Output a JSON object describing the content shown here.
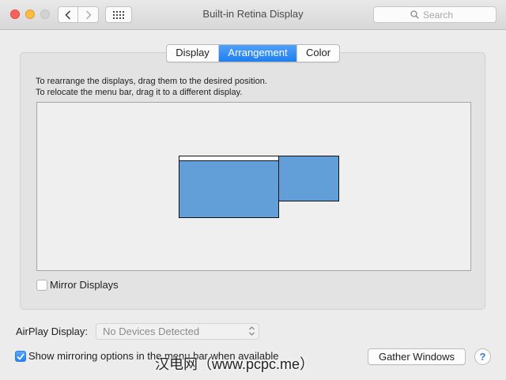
{
  "window": {
    "title": "Built-in Retina Display"
  },
  "toolbar": {
    "back_icon": "chevron-left-icon",
    "forward_icon": "chevron-right-icon",
    "show_all_icon": "grid-icon",
    "search_placeholder": "Search"
  },
  "tabs": [
    {
      "label": "Display",
      "selected": false
    },
    {
      "label": "Arrangement",
      "selected": true
    },
    {
      "label": "Color",
      "selected": false
    }
  ],
  "arrangement": {
    "instruction_line1": "To rearrange the displays, drag them to the desired position.",
    "instruction_line2": "To relocate the menu bar, drag it to a different display.",
    "display_color": "#629fd8",
    "mirror_label": "Mirror Displays",
    "mirror_checked": false
  },
  "airplay": {
    "label": "AirPlay Display:",
    "selected": "No Devices Detected"
  },
  "mirroring_options": {
    "label": "Show mirroring options in the menu bar when available",
    "checked": true
  },
  "buttons": {
    "gather_windows": "Gather Windows",
    "help": "?"
  },
  "watermark": "汉电网（www.pcpc.me）",
  "colors": {
    "accent": "#2382f1",
    "close": "#fc605c",
    "minimize": "#fdbc40",
    "zoom_disabled": "#d3d3d3"
  }
}
